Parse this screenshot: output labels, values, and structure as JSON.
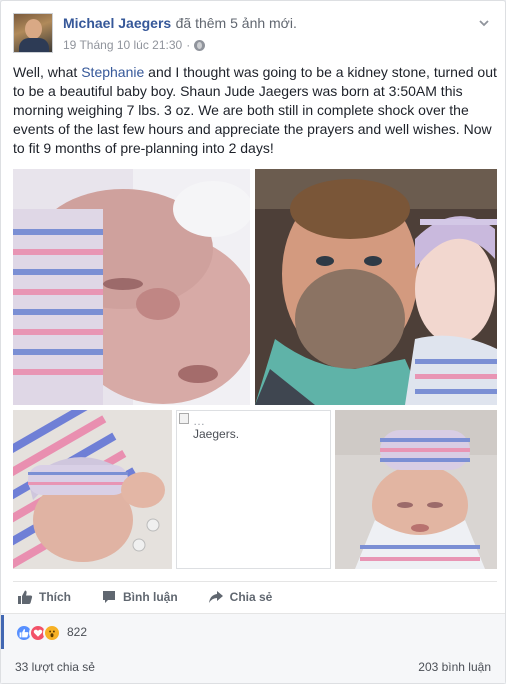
{
  "post": {
    "author": "Michael Jaegers",
    "action": "đã thêm 5 ảnh mới.",
    "timestamp": "19 Tháng 10 lúc 21:30",
    "separator": "·",
    "privacy_icon": "globe-icon",
    "text_part1": "Well, what ",
    "mention": "Stephanie",
    "text_part2": " and I thought was going to be a kidney stone, turned out to be a beautiful baby boy. Shaun Jude Jaegers was born at 3:50AM this morning weighing 7 lbs. 3 oz. We are both still in complete shock over the events of the last few hours and appreciate the prayers and well wishes. Now to fit 9 months of pre-planning into 2 days!"
  },
  "photos": {
    "broken_alt_line1": "…",
    "broken_alt_line2": "Jaegers."
  },
  "actions": {
    "like": "Thích",
    "comment": "Bình luận",
    "share": "Chia sẻ"
  },
  "reactions": {
    "types": [
      "like",
      "love",
      "wow"
    ],
    "count": "822"
  },
  "footer": {
    "shares": "33 lượt chia sẻ",
    "comments": "203 bình luận"
  },
  "colors": {
    "link": "#365899",
    "like": "#5890ff",
    "love": "#f25268",
    "wow": "#f7b125"
  }
}
